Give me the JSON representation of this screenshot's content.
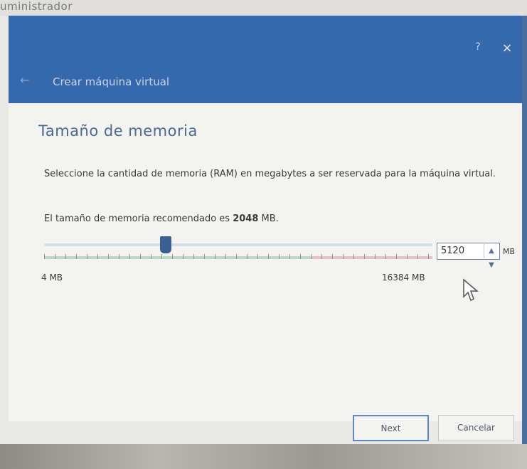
{
  "window": {
    "background_title": "uministrador",
    "help_label": "?",
    "close_label": "×",
    "back_icon": "back-arrow-icon",
    "wizard_title": "Crear máquina virtual"
  },
  "page": {
    "title": "Tamaño de memoria",
    "description": "Seleccione la cantidad de memoria (RAM) en megabytes a ser reservada para la máquina virtual.",
    "recommended_prefix": "El tamaño de memoria recomendado es ",
    "recommended_value": "2048",
    "recommended_suffix": " MB."
  },
  "memory": {
    "min_mb": 4,
    "max_mb": 16384,
    "current_mb": 5120,
    "min_label": "4 MB",
    "max_label": "16384 MB",
    "spin_value": "5120",
    "unit_label": "MB"
  },
  "buttons": {
    "next_label": "Next",
    "cancel_label": "Cancelar"
  },
  "colors": {
    "accent": "#3668ad",
    "thumb": "#3c5f92",
    "safe_range": "#bcd9c3",
    "danger_range": "#e6c2c7"
  }
}
